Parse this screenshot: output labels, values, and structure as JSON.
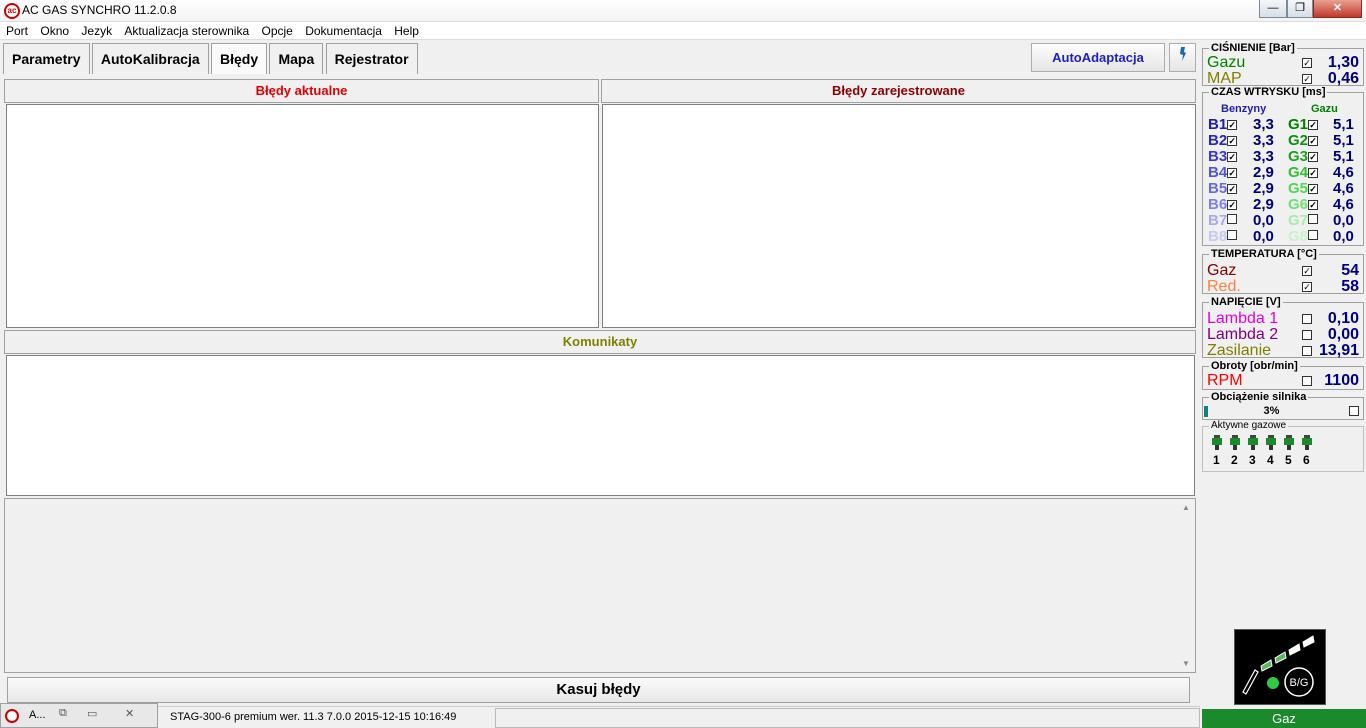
{
  "window": {
    "title": "AC GAS SYNCHRO  11.2.0.8",
    "min": "—",
    "max": "❐",
    "close": "✕"
  },
  "menu": [
    "Port",
    "Okno",
    "Jezyk",
    "Aktualizacja sterownika",
    "Opcje",
    "Dokumentacja",
    "Help"
  ],
  "tabs": [
    {
      "label": "Parametry",
      "active": false
    },
    {
      "label": "AutoKalibracja",
      "active": false
    },
    {
      "label": "Błędy",
      "active": true
    },
    {
      "label": "Mapa",
      "active": false
    },
    {
      "label": "Rejestrator",
      "active": false
    }
  ],
  "toolbar": {
    "autoadapt": "AutoAdaptacja",
    "extra_icon": "wrench-icon"
  },
  "panels": {
    "errors_actual": "Błędy aktualne",
    "errors_registered": "Błędy zarejestrowane",
    "messages": "Komunikaty",
    "clear_button": "Kasuj błędy"
  },
  "status": {
    "task_label": "A...",
    "text": "STAG-300-6 premium   wer. 11.3  7.0.0    2015-12-15 10:16:49",
    "fuel": "Gaz"
  },
  "right": {
    "pressure": {
      "title": "CIŚNIENIE [Bar]",
      "gas_label": "Gazu",
      "gas_value": "1,30",
      "gas_checked": true,
      "map_label": "MAP",
      "map_value": "0,46",
      "map_checked": true
    },
    "injection": {
      "title": "CZAS WTRYSKU  [ms]",
      "petrol_header": "Benzyny",
      "gas_header": "Gazu",
      "petrol": [
        {
          "label": "B1",
          "value": "3,3",
          "checked": true,
          "color": "#2020b0"
        },
        {
          "label": "B2",
          "value": "3,3",
          "checked": true,
          "color": "#2828c0"
        },
        {
          "label": "B3",
          "value": "3,3",
          "checked": true,
          "color": "#3a3ad0"
        },
        {
          "label": "B4",
          "value": "2,9",
          "checked": true,
          "color": "#5555d8"
        },
        {
          "label": "B5",
          "value": "2,9",
          "checked": true,
          "color": "#6a6ae0"
        },
        {
          "label": "B6",
          "value": "2,9",
          "checked": true,
          "color": "#8080e8"
        },
        {
          "label": "B7",
          "value": "0,0",
          "checked": false,
          "color": "#a8a8ee"
        },
        {
          "label": "B8",
          "value": "0,0",
          "checked": false,
          "color": "#c8c8f4"
        }
      ],
      "gas": [
        {
          "label": "G1",
          "value": "5,1",
          "checked": true,
          "color": "#008000"
        },
        {
          "label": "G2",
          "value": "5,1",
          "checked": true,
          "color": "#109010"
        },
        {
          "label": "G3",
          "value": "5,1",
          "checked": true,
          "color": "#20a020"
        },
        {
          "label": "G4",
          "value": "4,6",
          "checked": true,
          "color": "#30c030"
        },
        {
          "label": "G5",
          "value": "4,6",
          "checked": true,
          "color": "#50d850"
        },
        {
          "label": "G6",
          "value": "4,6",
          "checked": true,
          "color": "#70e070"
        },
        {
          "label": "G7",
          "value": "0,0",
          "checked": false,
          "color": "#a8eca8"
        },
        {
          "label": "G8",
          "value": "0,0",
          "checked": false,
          "color": "#c8f4c8"
        }
      ]
    },
    "temperature": {
      "title": "TEMPERATURA  [°C]",
      "gas_label": "Gaz",
      "gas_value": "54",
      "gas_checked": true,
      "red_label": "Red.",
      "red_value": "58",
      "red_checked": true
    },
    "voltage": {
      "title": "NAPIĘCIE [V]",
      "l1_label": "Lambda 1",
      "l1_value": "0,10",
      "l1_checked": false,
      "l2_label": "Lambda 2",
      "l2_value": "0,00",
      "l2_checked": false,
      "supply_label": "Zasilanie",
      "supply_value": "13,91",
      "supply_checked": false
    },
    "rpm": {
      "title": "Obroty [obr/min]",
      "label": "RPM",
      "value": "1100",
      "checked": false
    },
    "load": {
      "title": "Obciążenie silnika",
      "value": "3%",
      "fraction": 0.03,
      "checked": false
    },
    "active_gas": {
      "title": "Aktywne gazowe",
      "injectors": [
        "1",
        "2",
        "3",
        "4",
        "5",
        "6"
      ]
    },
    "logo": {
      "text": "B/G"
    }
  },
  "colors": {
    "gas_green": "#008000",
    "map_olive": "#808000",
    "value_navy": "#00007f",
    "red": "#e00000"
  }
}
